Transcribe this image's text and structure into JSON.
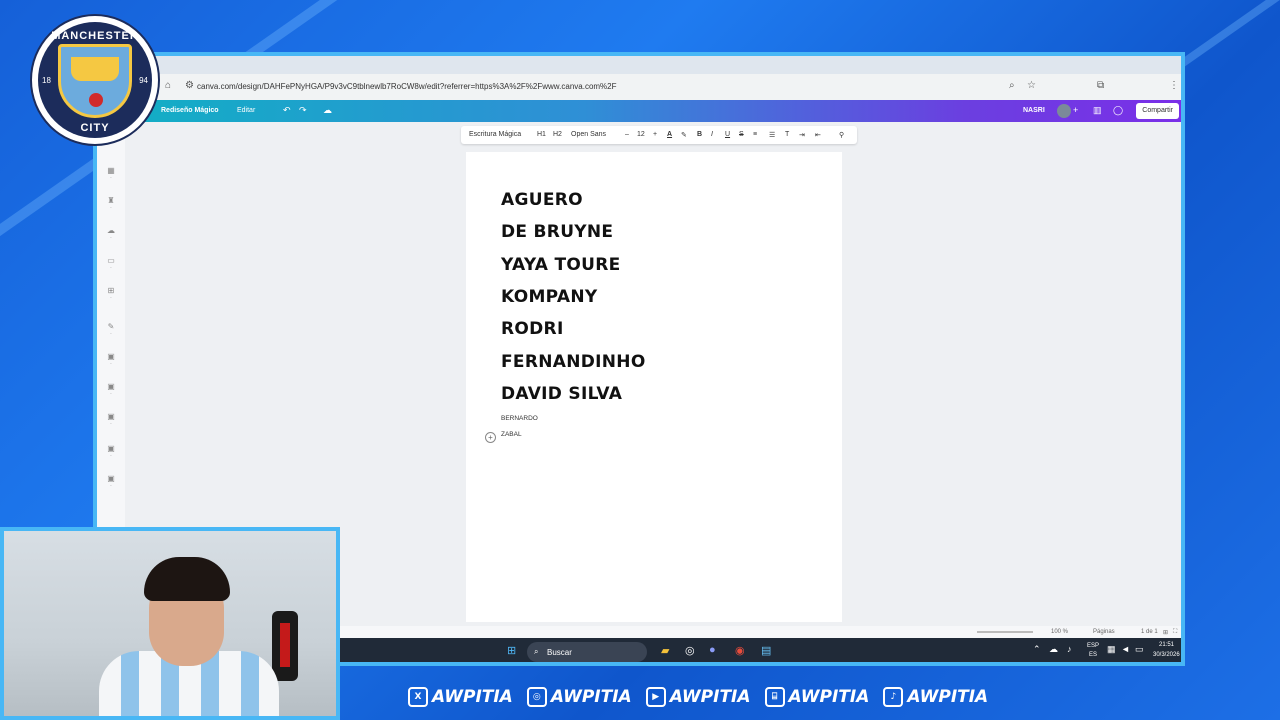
{
  "browser": {
    "url": "canva.com/design/DAHFePNyHGA/P9v3vC9tblnewlb7RoCW8w/edit?referrer=https%3A%2F%2Fwww.canva.com%2F"
  },
  "canva": {
    "magic_label": "Rediseño Mágico",
    "edit_label": "Editar",
    "user_label": "NASRI",
    "share_label": "Compartir"
  },
  "toolbar": {
    "magic_write": "Escritura Mágica",
    "h1": "H1",
    "h2": "H2",
    "font": "Open Sans",
    "size": "12",
    "minus": "–",
    "plus": "+"
  },
  "document": {
    "lines": [
      "AGUERO",
      "DE BRUYNE",
      "YAYA TOURE",
      "KOMPANY",
      "RODRI",
      "FERNANDINHO",
      "DAVID SILVA"
    ],
    "small_lines": [
      "BERNARDO",
      "ZABAL"
    ]
  },
  "statusbar": {
    "zoom": "100 %",
    "pages_label": "Páginas",
    "page_count": "1 de 1"
  },
  "taskbar": {
    "search": "Buscar",
    "lang": "ESP",
    "region": "ES",
    "time": "21:51",
    "date": "30/3/2026"
  },
  "badge": {
    "top": "MANCHESTER",
    "bottom": "CITY",
    "year_left": "18",
    "year_right": "94"
  },
  "socials": [
    "AWPITIA",
    "AWPITIA",
    "AWPITIA",
    "AWPITIA",
    "AWPITIA"
  ],
  "colors": {
    "accent": "#48b7f5",
    "city_blue": "#6cabdd",
    "navy": "#1c2c5b"
  }
}
